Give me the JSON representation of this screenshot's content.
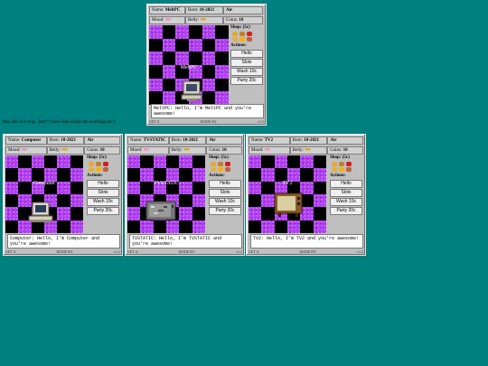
{
  "notice": "this site is a wip.. but!!! have this while im working on it",
  "labels": {
    "name": "Name:",
    "born": "Born:",
    "mood": "Mood:",
    "belly": "Belly:",
    "coins": "Coins:",
    "shop": "Shop: (5c)",
    "actions": "Actions:",
    "btn_hello": "Hello",
    "btn_slots": "Slots",
    "btn_wash": "Wash 10c",
    "btn_party": "Party 20c",
    "foot_left": "GET A",
    "foot_mid": "MADE BY",
    "foot_right": "v1.2"
  },
  "pets": [
    {
      "name": "MeltPC",
      "born": "10-2021",
      "type": "Air",
      "mood": "♥♥♥",
      "belly": "♥♥♥",
      "coins": "10",
      "message": "MeltPC: Hello, I'm MeltPC and you're awesome!"
    },
    {
      "name": "Computer",
      "born": "10-2021",
      "type": "Air",
      "mood": "♥♥♥",
      "belly": "♥♥♥",
      "coins": "10",
      "message": "Computer: Hello, I'm Computer and you're awesome!"
    },
    {
      "name": "TVSTATIC",
      "born": "10-2021",
      "type": "Air",
      "mood": "♥♥♥",
      "belly": "♥♥♥",
      "coins": "10",
      "message": "TVSTATIC: Hello, I'm TVSTATIC and you're awesome!"
    },
    {
      "name": "TV2",
      "born": "10-2021",
      "type": "Air",
      "mood": "♥♥♥",
      "belly": "♥♥♥",
      "coins": "10",
      "message": "TV2: Hello, I'm TV2 and you're awesome!"
    }
  ],
  "colors": {
    "background": "#00807f",
    "magenta": "#b040f0",
    "panel": "#bfbfbf"
  }
}
